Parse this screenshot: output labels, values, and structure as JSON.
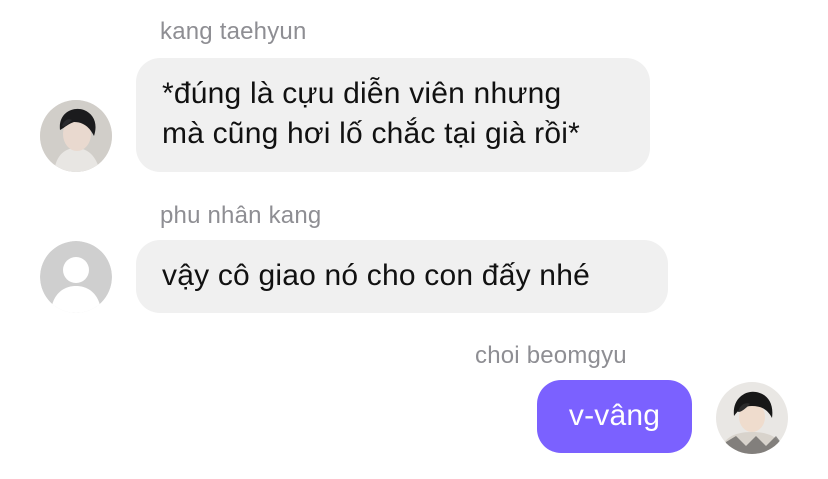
{
  "messages": [
    {
      "sender": "kang taehyun",
      "lines": [
        "*đúng là cựu diễn viên nhưng",
        "mà cũng hơi lố chắc tại già rồi*"
      ],
      "direction": "incoming",
      "avatar": "profile-photo"
    },
    {
      "sender": "phu nhân kang",
      "lines": [
        "vậy cô giao nó cho con đấy nhé"
      ],
      "direction": "incoming",
      "avatar": "default-user-icon"
    },
    {
      "sender": "choi beomgyu",
      "lines": [
        "v-vâng"
      ],
      "direction": "outgoing",
      "avatar": "profile-photo"
    }
  ],
  "colors": {
    "incoming_bubble": "#f0f0f0",
    "outgoing_bubble": "#7b61ff",
    "sender_name": "#8e8e93"
  }
}
